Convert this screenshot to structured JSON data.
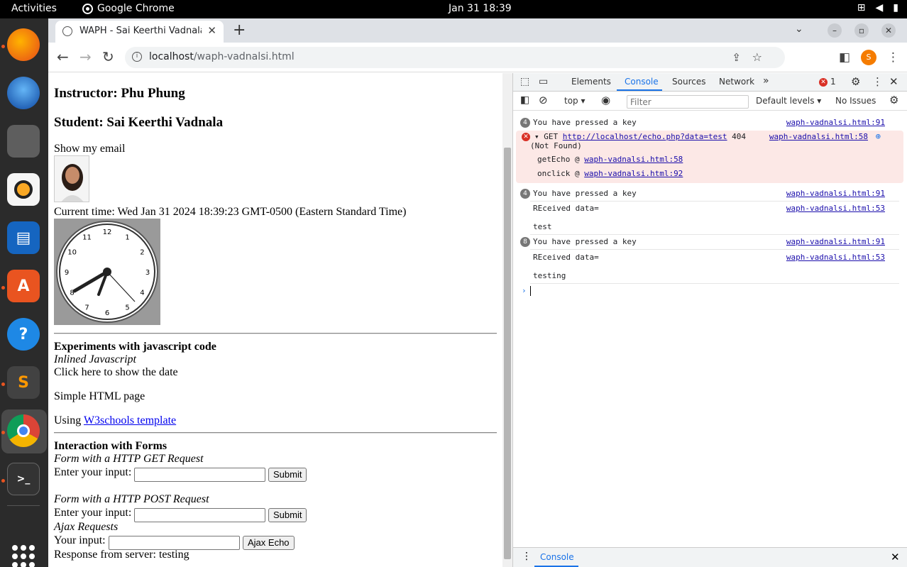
{
  "topbar": {
    "activities": "Activities",
    "app_name": "Google Chrome",
    "clock": "Jan 31  18:39"
  },
  "browser": {
    "tab_title": "WAPH - Sai Keerthi Vadnala",
    "url_host": "localhost",
    "url_path": "/waph-vadnalsi.html",
    "profile_initial": "S"
  },
  "page": {
    "instructor": "Instructor: Phu Phung",
    "student": "Student: Sai Keerthi Vadnala",
    "show_email": "Show my email",
    "current_time": "Current time: Wed Jan 31 2024 18:39:23 GMT-0500 (Eastern Standard Time)",
    "clock_numbers": [
      "12",
      "1",
      "2",
      "3",
      "4",
      "5",
      "6",
      "7",
      "8",
      "9",
      "10",
      "11"
    ],
    "js_heading": "Experiments with javascript code",
    "inlined_js": "Inlined Javascript",
    "click_date": "Click here to show the date",
    "simple_html": "Simple HTML page",
    "using_prefix": "Using ",
    "w3_link": "W3schools template",
    "forms_heading": "Interaction with Forms",
    "get_form_title": "Form with a HTTP GET Request",
    "post_form_title": "Form with a HTTP POST Request",
    "enter_input_label": "Enter your input:",
    "submit_label": "Submit",
    "ajax_title": "Ajax Requests",
    "your_input_label": "Your input:",
    "ajax_button": "Ajax Echo",
    "response": "Response from server: testing"
  },
  "devtools": {
    "tabs": [
      "Elements",
      "Console",
      "Sources",
      "Network"
    ],
    "active_tab": "Console",
    "error_count": "1",
    "context": "top",
    "filter_placeholder": "Filter",
    "levels": "Default levels",
    "issues": "No Issues",
    "messages": [
      {
        "count": "4",
        "text": "You have pressed a key",
        "source": "waph-vadnalsi.html:91"
      },
      {
        "method": "GET",
        "url": "http://localhost/echo.php?data=test",
        "status": "404",
        "status_text": "(Not Found)",
        "source": "waph-vadnalsi.html:58",
        "stack": [
          {
            "fn": "getEcho @ ",
            "loc": "waph-vadnalsi.html:58"
          },
          {
            "fn": "onclick @ ",
            "loc": "waph-vadnalsi.html:92"
          }
        ]
      },
      {
        "count": "4",
        "text": "You have pressed a key",
        "source": "waph-vadnalsi.html:91"
      },
      {
        "text": "REceived data=",
        "source": "waph-vadnalsi.html:53"
      },
      {
        "text": "test"
      },
      {
        "count": "8",
        "text": "You have pressed a key",
        "source": "waph-vadnalsi.html:91"
      },
      {
        "text": "REceived data=",
        "source": "waph-vadnalsi.html:53"
      },
      {
        "text": "testing"
      }
    ],
    "drawer_tab": "Console"
  }
}
